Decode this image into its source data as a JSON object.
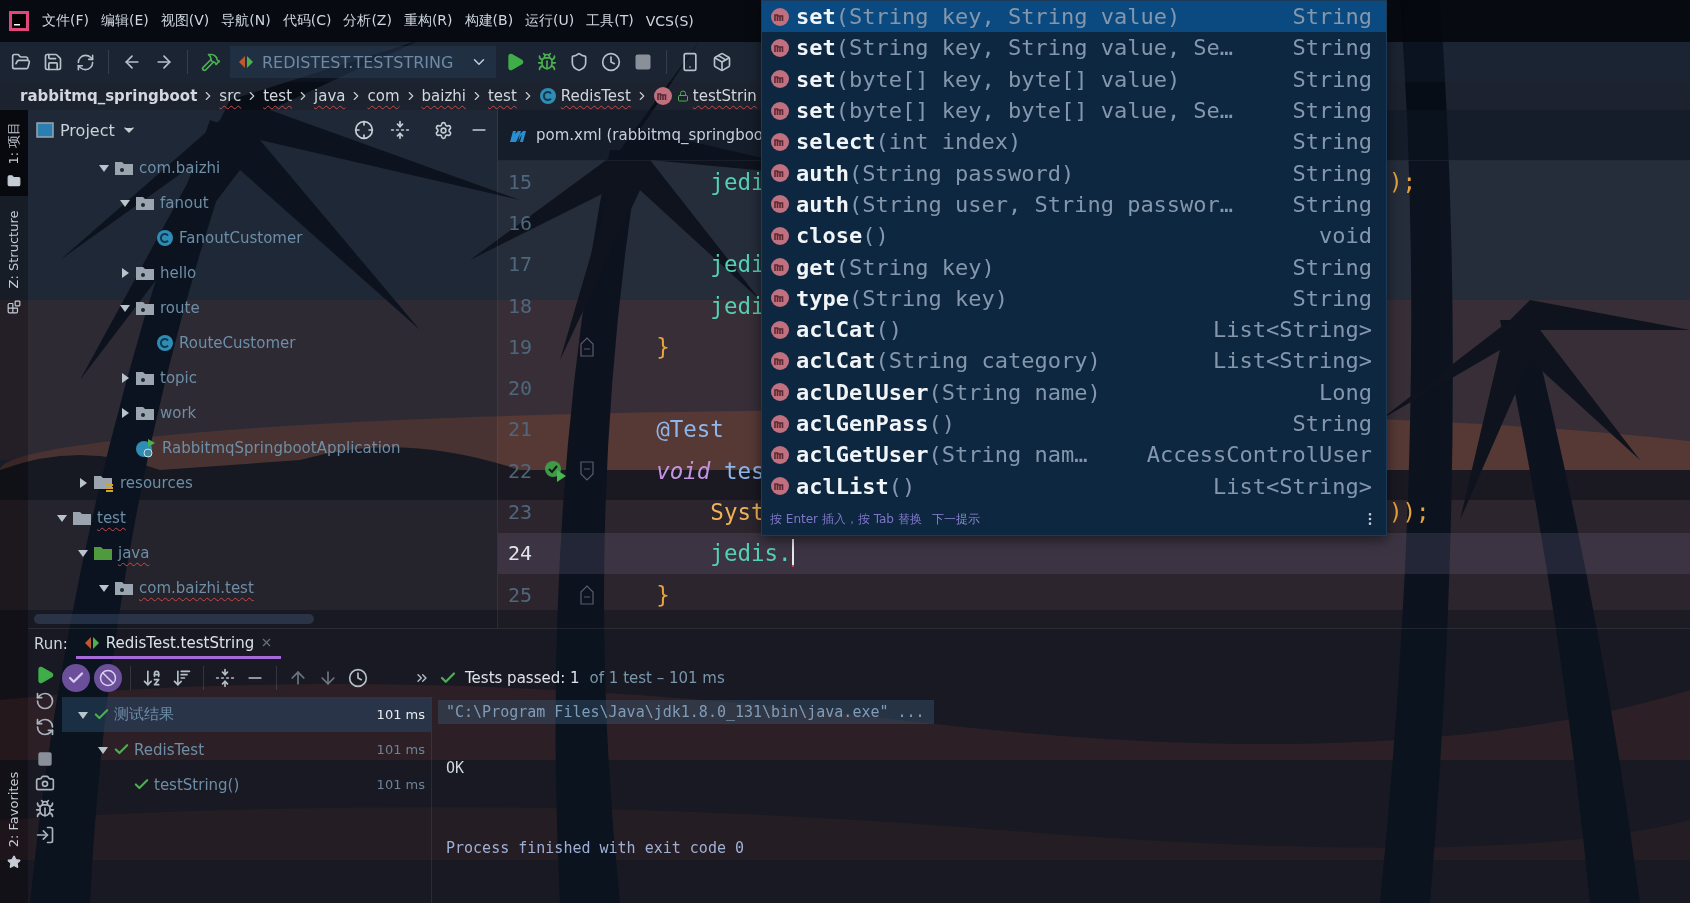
{
  "menu_bar": {
    "items": [
      "文件(F)",
      "编辑(E)",
      "视图(V)",
      "导航(N)",
      "代码(C)",
      "分析(Z)",
      "重构(R)",
      "构建(B)",
      "运行(U)",
      "工具(T)",
      "VCS(S)"
    ]
  },
  "toolbar": {
    "run_configuration": "REDISTEST.TESTSTRING"
  },
  "breadcrumbs": [
    {
      "label": "rabbitmq_springboot",
      "kind": "project",
      "squiggle": false
    },
    {
      "label": "src",
      "kind": "folder",
      "squiggle": true
    },
    {
      "label": "test",
      "kind": "folder",
      "squiggle": true
    },
    {
      "label": "java",
      "kind": "folder",
      "squiggle": true
    },
    {
      "label": "com",
      "kind": "folder",
      "squiggle": true
    },
    {
      "label": "baizhi",
      "kind": "folder",
      "squiggle": true
    },
    {
      "label": "test",
      "kind": "folder",
      "squiggle": true
    },
    {
      "label": "RedisTest",
      "kind": "class",
      "squiggle": true
    },
    {
      "label": "testStrin",
      "kind": "method",
      "squiggle": true
    }
  ],
  "tool_strip": {
    "top": [
      {
        "label": "1: 项目",
        "selected": true
      },
      {
        "label": "Z: Structure",
        "selected": false
      }
    ],
    "bottom": [
      {
        "label": "2: Favorites"
      }
    ]
  },
  "project_panel": {
    "title": "Project",
    "tree": [
      {
        "children": [
          {
            "children": [
              {
                "label": "com.baizhi",
                "kind": "package",
                "expanded": true,
                "squiggle": false,
                "children": [
                  {
                    "label": "fanout",
                    "kind": "package",
                    "expanded": true,
                    "squiggle": false,
                    "children": [
                      {
                        "label": "FanoutCustomer",
                        "kind": "class",
                        "squiggle": false
                      }
                    ]
                  },
                  {
                    "label": "hello",
                    "kind": "package",
                    "expanded": false,
                    "squiggle": false
                  },
                  {
                    "label": "route",
                    "kind": "package",
                    "expanded": true,
                    "squiggle": false,
                    "children": [
                      {
                        "label": "RouteCustomer",
                        "kind": "class",
                        "squiggle": false
                      }
                    ]
                  },
                  {
                    "label": "topic",
                    "kind": "package",
                    "expanded": false,
                    "squiggle": false
                  },
                  {
                    "label": "work",
                    "kind": "package",
                    "expanded": false,
                    "squiggle": false
                  },
                  {
                    "label": "RabbitmqSpringbootApplication",
                    "kind": "app",
                    "squiggle": false
                  }
                ]
              }
            ]
          },
          {
            "label": "resources",
            "kind": "resources",
            "expanded": false,
            "squiggle": false
          }
        ]
      },
      {
        "label": "test",
        "kind": "folder",
        "expanded": true,
        "squiggle": true,
        "children": [
          {
            "label": "java",
            "kind": "test-source",
            "expanded": true,
            "squiggle": true,
            "children": [
              {
                "label": "com.baizhi.test",
                "kind": "package",
                "expanded": true,
                "squiggle": true
              }
            ]
          }
        ]
      }
    ]
  },
  "editor": {
    "tab": {
      "label": "pom.xml (rabbitmq_springboo",
      "kind": "maven"
    },
    "lines": [
      {
        "number": "15",
        "parts": [
          {
            "text": "        jedi",
            "kind": "field"
          }
        ],
        "tail": [
          {
            "text": ");",
            "kind": "punct"
          }
        ],
        "run_icon": false,
        "fold_start": false,
        "fold_end": false,
        "current": false
      },
      {
        "number": "16",
        "run_icon": false,
        "fold_start": false,
        "fold_end": false,
        "current": false
      },
      {
        "number": "17",
        "parts": [
          {
            "text": "        jedi",
            "kind": "field"
          }
        ],
        "run_icon": false,
        "fold_start": false,
        "fold_end": false,
        "current": false
      },
      {
        "number": "18",
        "parts": [
          {
            "text": "        jedi",
            "kind": "field"
          }
        ],
        "run_icon": false,
        "fold_start": false,
        "fold_end": false,
        "current": false
      },
      {
        "number": "19",
        "parts": [
          {
            "text": "    }",
            "kind": "punct"
          }
        ],
        "run_icon": false,
        "fold_start": false,
        "fold_end": true,
        "current": false
      },
      {
        "number": "20",
        "run_icon": false,
        "fold_start": false,
        "fold_end": false,
        "current": false
      },
      {
        "number": "21",
        "parts": [
          {
            "text": "    @Test",
            "kind": "annotation"
          }
        ],
        "run_icon": false,
        "fold_start": false,
        "fold_end": false,
        "current": false
      },
      {
        "number": "22",
        "parts": [
          {
            "text": "    void",
            "kind": "keyword"
          },
          {
            "text": " tes",
            "kind": "method"
          }
        ],
        "run_icon": true,
        "fold_start": true,
        "fold_end": false,
        "current": false
      },
      {
        "number": "23",
        "parts": [
          {
            "text": "        Syst",
            "kind": "class"
          }
        ],
        "tail": [
          {
            "text": "));",
            "kind": "punct"
          }
        ],
        "run_icon": false,
        "fold_start": false,
        "fold_end": false,
        "current": false
      },
      {
        "number": "24",
        "parts": [
          {
            "text": "        jedis.",
            "kind": "field"
          }
        ],
        "run_icon": false,
        "fold_start": false,
        "fold_end": false,
        "current": true
      },
      {
        "number": "25",
        "parts": [
          {
            "text": "    }",
            "kind": "punct"
          }
        ],
        "run_icon": false,
        "fold_start": false,
        "fold_end": true,
        "current": false
      }
    ]
  },
  "completion": {
    "items": [
      {
        "name": "set",
        "params": "(String key, String value)",
        "type": "String",
        "selected": true
      },
      {
        "name": "set",
        "params": "(String key, String value, Se…",
        "type": "String",
        "selected": false
      },
      {
        "name": "set",
        "params": "(byte[] key, byte[] value)",
        "type": "String",
        "selected": false
      },
      {
        "name": "set",
        "params": "(byte[] key, byte[] value, Se…",
        "type": "String",
        "selected": false
      },
      {
        "name": "select",
        "params": "(int index)",
        "type": "String",
        "selected": false
      },
      {
        "name": "auth",
        "params": "(String password)",
        "type": "String",
        "selected": false
      },
      {
        "name": "auth",
        "params": "(String user, String passwor…",
        "type": "String",
        "selected": false
      },
      {
        "name": "close",
        "params": "()",
        "type": "void",
        "selected": false
      },
      {
        "name": "get",
        "params": "(String key)",
        "type": "String",
        "selected": false
      },
      {
        "name": "type",
        "params": "(String key)",
        "type": "String",
        "selected": false
      },
      {
        "name": "aclCat",
        "params": "()",
        "type": "List<String>",
        "selected": false
      },
      {
        "name": "aclCat",
        "params": "(String category)",
        "type": "List<String>",
        "selected": false
      },
      {
        "name": "aclDelUser",
        "params": "(String name)",
        "type": "Long",
        "selected": false
      },
      {
        "name": "aclGenPass",
        "params": "()",
        "type": "String",
        "selected": false
      },
      {
        "name": "aclGetUser",
        "params": "(String nam…",
        "type": "AccessControlUser",
        "selected": false
      },
      {
        "name": "aclList",
        "params": "()",
        "type": "List<String>",
        "selected": false
      }
    ],
    "hint": "按 Enter 插入，按 Tab 替换",
    "hint_link": "下一提示"
  },
  "run_panel": {
    "label": "Run:",
    "tab": {
      "label": "RedisTest.testString",
      "selected": true
    },
    "filters": [
      {
        "kind": "passed",
        "on": true
      },
      {
        "kind": "ignored",
        "on": true
      }
    ],
    "status": {
      "summary": "Tests passed: 1",
      "detail": "of 1 test – 101 ms"
    },
    "results": [
      {
        "label": "测试结果",
        "time": "101 ms",
        "passed": true,
        "expanded": true,
        "selected": true,
        "children": [
          {
            "label": "RedisTest",
            "time": "101 ms",
            "passed": true,
            "expanded": true,
            "selected": false,
            "children": [
              {
                "label": "testString()",
                "time": "101 ms",
                "passed": true,
                "selected": false
              }
            ]
          }
        ]
      }
    ],
    "console": [
      {
        "text": "\"C:\\Program Files\\Java\\jdk1.8.0_131\\bin\\java.exe\" ...",
        "kind": "command"
      },
      {
        "text": "OK",
        "kind": "output"
      },
      {
        "text": "Process finished with exit code 0",
        "kind": "exit"
      }
    ]
  }
}
